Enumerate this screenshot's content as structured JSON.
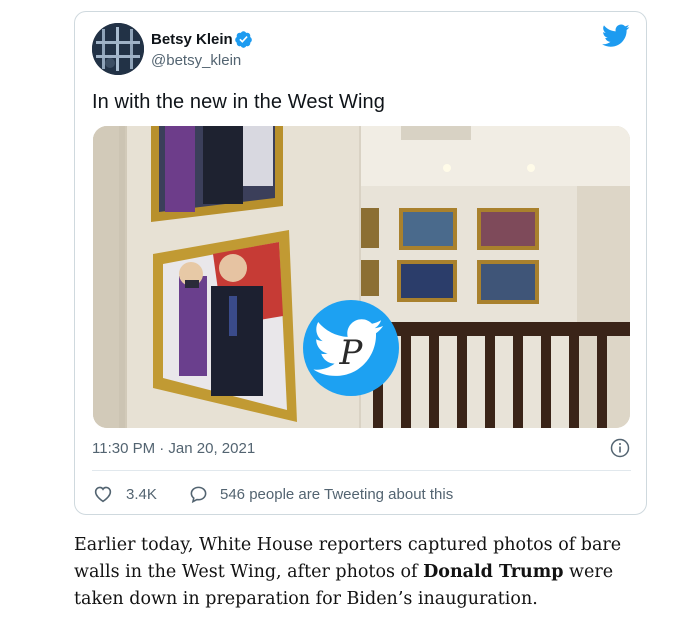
{
  "tweet": {
    "author_name": "Betsy Klein",
    "author_handle": "@betsy_klein",
    "text": "In with the new in the West Wing",
    "time": "11:30 PM · Jan 20, 2021",
    "like_count": "3.4K",
    "tweeting_text": "546 people are Tweeting about this"
  },
  "article": {
    "part1": "Earlier today, White House reporters captured photos of bare walls in the West Wing, after photos of ",
    "bold": "Donald Trump",
    "part2": " were taken down in preparation for Biden’s inauguration."
  },
  "colors": {
    "twitter_blue": "#1d9bf0",
    "secondary_text": "#536471"
  },
  "icons": [
    "verified-icon",
    "twitter-logo-icon",
    "info-icon",
    "heart-icon",
    "reply-icon"
  ]
}
